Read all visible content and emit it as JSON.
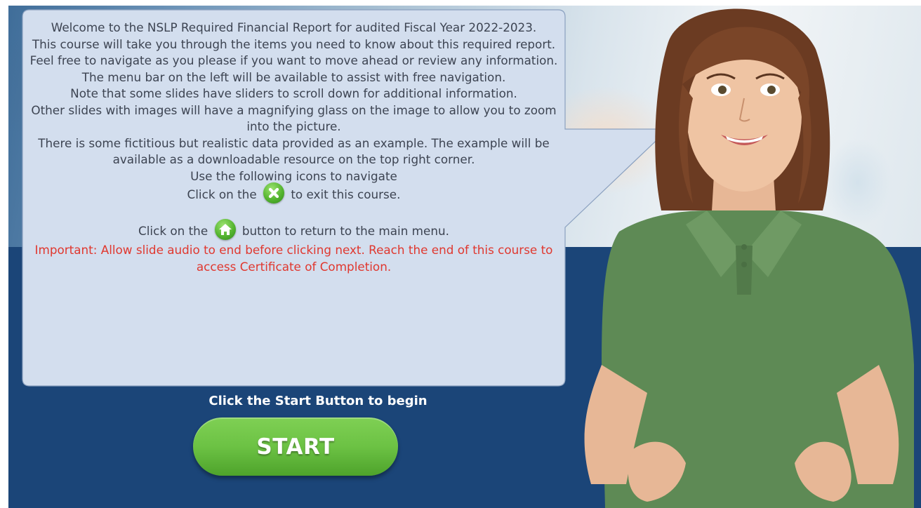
{
  "bubble": {
    "lines": [
      "Welcome to the NSLP Required Financial Report for audited Fiscal Year 2022-2023.",
      "This course will take you through the items you need to know about this required report. Feel free to navigate as you please if you want to move ahead or review any information.",
      "The menu bar on the left will be available to assist with free navigation.",
      "Note that some slides have sliders to scroll down for additional information.",
      "Other slides with images will have a magnifying glass on the image to allow you to zoom into the picture.",
      "There is some fictitious but realistic data provided as an example. The example will be available as a downloadable resource on the top right corner.",
      "Use the following icons to navigate"
    ],
    "exit_before": "Click on the",
    "exit_after": "to exit this course.",
    "home_before": "Click on the",
    "home_after": "button to return to the main menu.",
    "important": "Important: Allow slide audio to end before clicking next. Reach the end of this course to access Certificate of Completion."
  },
  "cta": {
    "instruction": "Click the Start Button to begin",
    "start_label": "START"
  },
  "icons": {
    "exit": "close-icon",
    "home": "home-icon"
  },
  "colors": {
    "background": "#1b4578",
    "bubble": "#d3deee",
    "important_text": "#e0382f",
    "start_button": "#6cc244",
    "shirt": "#5e8a55"
  }
}
